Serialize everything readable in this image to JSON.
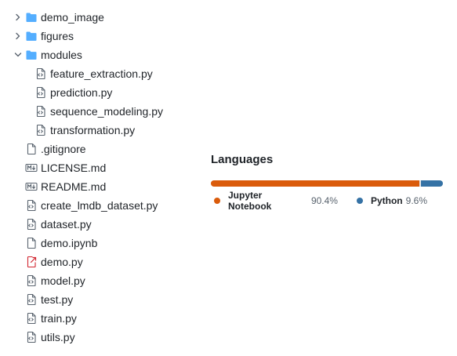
{
  "tree": [
    {
      "label": "demo_image",
      "type": "folder",
      "expanded": false
    },
    {
      "label": "figures",
      "type": "folder",
      "expanded": false
    },
    {
      "label": "modules",
      "type": "folder",
      "expanded": true
    },
    {
      "label": "feature_extraction.py",
      "type": "code"
    },
    {
      "label": "prediction.py",
      "type": "code"
    },
    {
      "label": "sequence_modeling.py",
      "type": "code"
    },
    {
      "label": "transformation.py",
      "type": "code"
    },
    {
      "label": ".gitignore",
      "type": "file"
    },
    {
      "label": "LICENSE.md",
      "type": "markdown"
    },
    {
      "label": "README.md",
      "type": "markdown"
    },
    {
      "label": "create_lmdb_dataset.py",
      "type": "code"
    },
    {
      "label": "dataset.py",
      "type": "code"
    },
    {
      "label": "demo.ipynb",
      "type": "file"
    },
    {
      "label": "demo.py",
      "type": "link"
    },
    {
      "label": "model.py",
      "type": "code"
    },
    {
      "label": "test.py",
      "type": "code"
    },
    {
      "label": "train.py",
      "type": "code"
    },
    {
      "label": "utils.py",
      "type": "code"
    }
  ],
  "languages": {
    "title": "Languages",
    "items": [
      {
        "name": "Jupyter Notebook",
        "percent_label": "90.4%",
        "value": 90.4,
        "color": "#DA5B0B"
      },
      {
        "name": "Python",
        "percent_label": "9.6%",
        "value": 9.6,
        "color": "#3572A5"
      }
    ]
  },
  "colors": {
    "folder": "#54aeff",
    "icon_gray": "#59636e",
    "link_icon": "#d1242f"
  }
}
